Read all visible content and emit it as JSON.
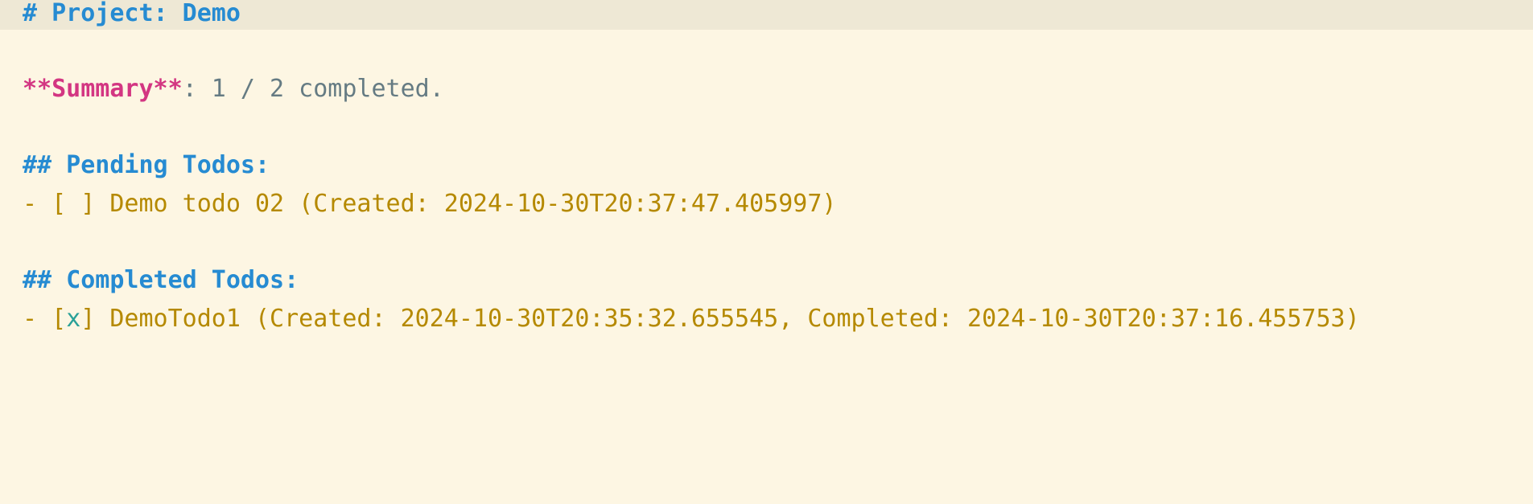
{
  "editor": {
    "lines": {
      "title": "# Project: Demo",
      "summary_marker": "**Summary**",
      "summary_rest": ": 1 / 2 completed.",
      "pending_heading": "## Pending Todos:",
      "pending_item_prefix": "- [",
      "pending_item_check": " ",
      "pending_item_rest": "] Demo todo 02 (Created: 2024-10-30T20:37:47.405997)",
      "completed_heading": "## Completed Todos:",
      "completed_item_prefix": "- [",
      "completed_item_check": "x",
      "completed_item_rest": "] DemoTodo1 (Created: 2024-10-30T20:35:32.655545, Completed: 2024-10-30T20:37:16.455753)"
    }
  }
}
